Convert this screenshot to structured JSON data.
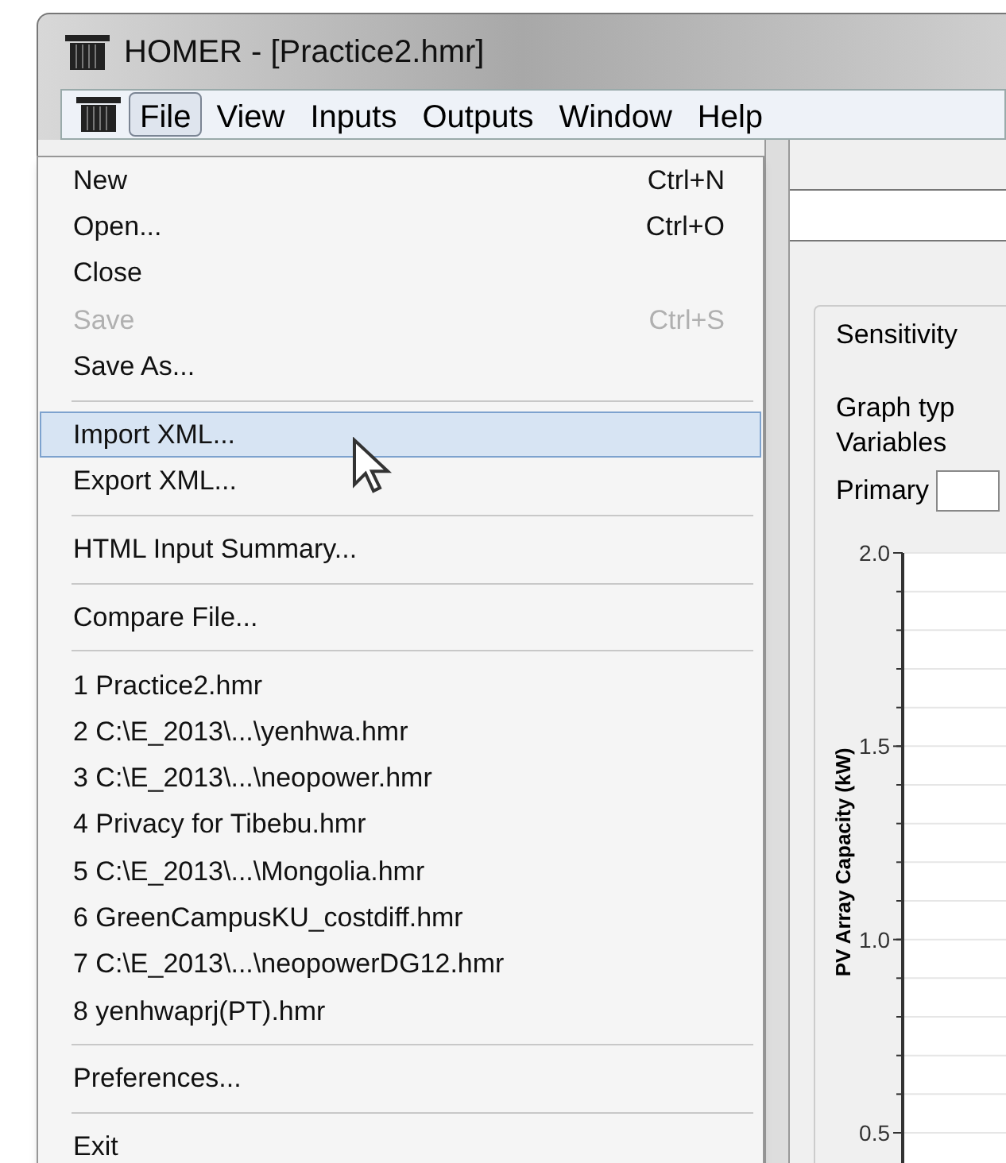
{
  "window": {
    "title": "HOMER - [Practice2.hmr]"
  },
  "menu_bar": [
    {
      "label": "File",
      "selected": true
    },
    {
      "label": "View",
      "selected": false
    },
    {
      "label": "Inputs",
      "selected": false
    },
    {
      "label": "Outputs",
      "selected": false
    },
    {
      "label": "Window",
      "selected": false
    },
    {
      "label": "Help",
      "selected": false
    }
  ],
  "file_menu": [
    {
      "kind": "item",
      "label": "New",
      "shortcut": "Ctrl+N",
      "disabled": false,
      "selected": false
    },
    {
      "kind": "item",
      "label": "Open...",
      "shortcut": "Ctrl+O",
      "disabled": false,
      "selected": false
    },
    {
      "kind": "item",
      "label": "Close",
      "disabled": false,
      "selected": false
    },
    {
      "kind": "item",
      "label": "Save",
      "shortcut": "Ctrl+S",
      "disabled": true,
      "selected": false
    },
    {
      "kind": "item",
      "label": "Save As...",
      "disabled": false,
      "selected": false
    },
    {
      "kind": "separator"
    },
    {
      "kind": "item",
      "label": "Import XML...",
      "disabled": false,
      "selected": true
    },
    {
      "kind": "item",
      "label": "Export XML...",
      "disabled": false,
      "selected": false
    },
    {
      "kind": "separator"
    },
    {
      "kind": "item",
      "label": "HTML Input Summary...",
      "disabled": false,
      "selected": false
    },
    {
      "kind": "separator"
    },
    {
      "kind": "item",
      "label": "Compare File...",
      "disabled": false,
      "selected": false
    },
    {
      "kind": "separator"
    },
    {
      "kind": "item",
      "label": "1 Practice2.hmr",
      "disabled": false,
      "selected": false
    },
    {
      "kind": "item",
      "label": "2 C:\\E_2013\\...\\yenhwa.hmr",
      "disabled": false,
      "selected": false
    },
    {
      "kind": "item",
      "label": "3 C:\\E_2013\\...\\neopower.hmr",
      "disabled": false,
      "selected": false
    },
    {
      "kind": "item",
      "label": "4 Privacy for Tibebu.hmr",
      "disabled": false,
      "selected": false
    },
    {
      "kind": "item",
      "label": "5 C:\\E_2013\\...\\Mongolia.hmr",
      "disabled": false,
      "selected": false
    },
    {
      "kind": "item",
      "label": "6 GreenCampusKU_costdiff.hmr",
      "disabled": false,
      "selected": false
    },
    {
      "kind": "item",
      "label": "7 C:\\E_2013\\...\\neopowerDG12.hmr",
      "disabled": false,
      "selected": false
    },
    {
      "kind": "item",
      "label": "8 yenhwaprj(PT).hmr",
      "disabled": false,
      "selected": false
    },
    {
      "kind": "separator"
    },
    {
      "kind": "item",
      "label": "Preferences...",
      "disabled": false,
      "selected": false
    },
    {
      "kind": "separator"
    },
    {
      "kind": "item",
      "label": "Exit",
      "disabled": false,
      "selected": false
    }
  ],
  "panel": {
    "tab": "Sensitivity",
    "graph_type_label": "Graph typ",
    "variables_label": "Variables",
    "primary_label": "Primary",
    "y_axis": {
      "label": "PV Array Capacity (kW)",
      "ticks": [
        "2.0",
        "1.5",
        "1.0",
        "0.5"
      ]
    }
  }
}
